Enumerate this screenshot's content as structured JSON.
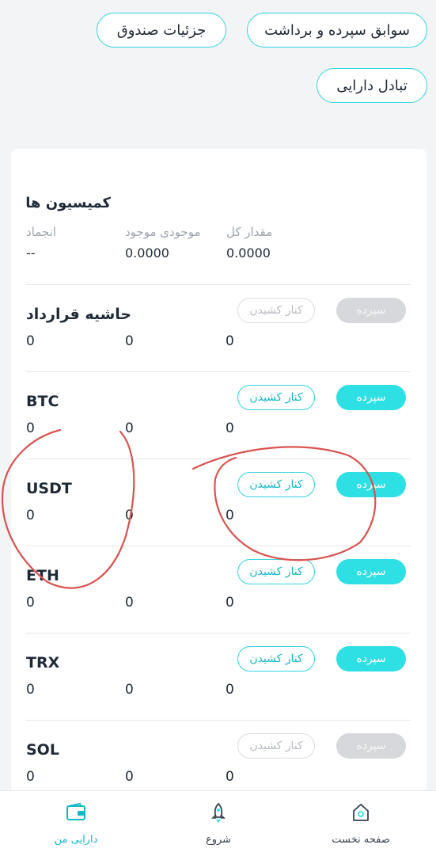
{
  "header": {
    "deposit_history_label": "سوابق سپرده و برداشت",
    "fund_details_label": "جزئیات صندوق",
    "asset_exchange_label": "تبادل دارایی"
  },
  "commission": {
    "title": "کمیسیون ها",
    "columns": [
      {
        "label": "مقدار کل",
        "value": "0.0000"
      },
      {
        "label": "موجودی موجود",
        "value": "0.0000"
      },
      {
        "label": "انجماد",
        "value": "--"
      }
    ]
  },
  "assets": [
    {
      "name": "حاشیه قرارداد",
      "values": [
        "0",
        "0",
        "0"
      ],
      "withdraw_label": "کنار کشیدن",
      "deposit_label": "سپرده",
      "enabled": false
    },
    {
      "name": "BTC",
      "values": [
        "0",
        "0",
        "0"
      ],
      "withdraw_label": "کنار کشیدن",
      "deposit_label": "سپرده",
      "enabled": true
    },
    {
      "name": "USDT",
      "values": [
        "0",
        "0",
        "0"
      ],
      "withdraw_label": "کنار کشیدن",
      "deposit_label": "سپرده",
      "enabled": true
    },
    {
      "name": "ETH",
      "values": [
        "0",
        "0",
        "0"
      ],
      "withdraw_label": "کنار کشیدن",
      "deposit_label": "سپرده",
      "enabled": true
    },
    {
      "name": "TRX",
      "values": [
        "0",
        "0",
        "0"
      ],
      "withdraw_label": "کنار کشیدن",
      "deposit_label": "سپرده",
      "enabled": true
    },
    {
      "name": "SOL",
      "values": [
        "0",
        "0",
        "0"
      ],
      "withdraw_label": "کنار کشیدن",
      "deposit_label": "سپرده",
      "enabled": false
    }
  ],
  "bottom_nav": {
    "items": [
      {
        "label": "دارایی من",
        "icon": "wallet-icon",
        "active": true
      },
      {
        "label": "شروع",
        "icon": "rocket-icon",
        "active": false
      },
      {
        "label": "صفحه نخست",
        "icon": "home-icon",
        "active": false
      }
    ]
  },
  "colors": {
    "accent": "#2ee0e4",
    "accent_text": "#14b8c9",
    "disabled": "#d6d8db",
    "annotation": "#d9534f"
  }
}
